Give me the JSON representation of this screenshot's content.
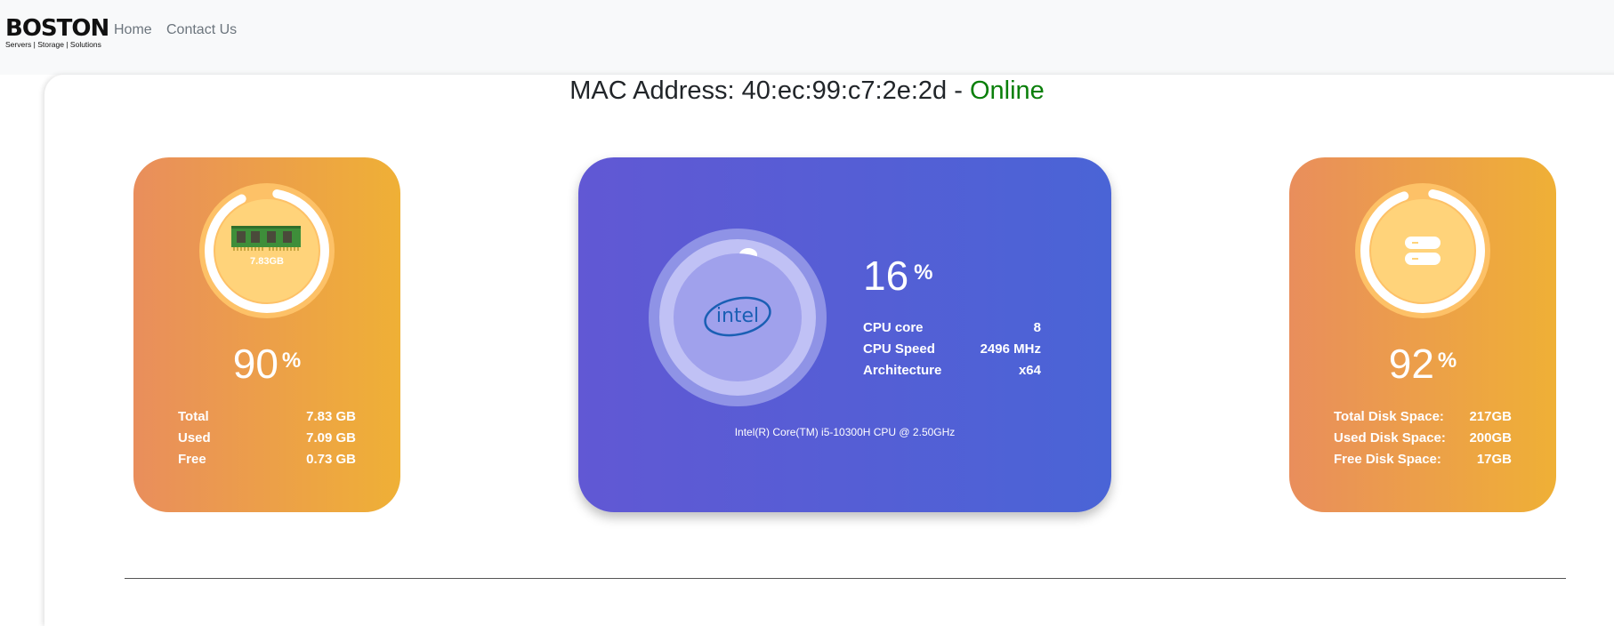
{
  "navbar": {
    "brand": {
      "name": "BOSTON",
      "tagline": "Servers | Storage | Solutions"
    },
    "links": [
      {
        "label": "Home"
      },
      {
        "label": "Contact Us"
      }
    ]
  },
  "header": {
    "mac_label": "MAC Address: 40:ec:99:c7:2e:2d -",
    "status": "Online",
    "status_color": "#0a7f0a"
  },
  "ram": {
    "chip_label": "7.83GB",
    "percent": "90",
    "percent_symbol": "%",
    "usage_fraction": 0.9,
    "stats": [
      {
        "label": "Total",
        "value": "7.83 GB"
      },
      {
        "label": "Used",
        "value": "7.09 GB"
      },
      {
        "label": "Free",
        "value": "0.73 GB"
      }
    ],
    "icon": "ram-chip-icon"
  },
  "cpu": {
    "percent": "16",
    "percent_symbol": "%",
    "usage_fraction": 0.16,
    "logo_text": "intel",
    "stats": [
      {
        "label": "CPU core",
        "value": "8"
      },
      {
        "label": "CPU Speed",
        "value": "2496 MHz"
      },
      {
        "label": "Architecture",
        "value": "x64"
      }
    ],
    "model": "Intel(R) Core(TM) i5-10300H CPU @ 2.50GHz"
  },
  "disk": {
    "percent": "92",
    "percent_symbol": "%",
    "usage_fraction": 0.92,
    "stats": [
      {
        "label": "Total Disk Space:",
        "value": "217GB"
      },
      {
        "label": "Used Disk Space:",
        "value": "200GB"
      },
      {
        "label": "Free Disk Space:",
        "value": "17GB"
      }
    ],
    "icon": "server-icon"
  },
  "colors": {
    "card_orange_start": "#e98e5c",
    "card_orange_end": "#efb036",
    "card_cpu_start": "#6158d4",
    "card_cpu_end": "#4a64d6"
  }
}
